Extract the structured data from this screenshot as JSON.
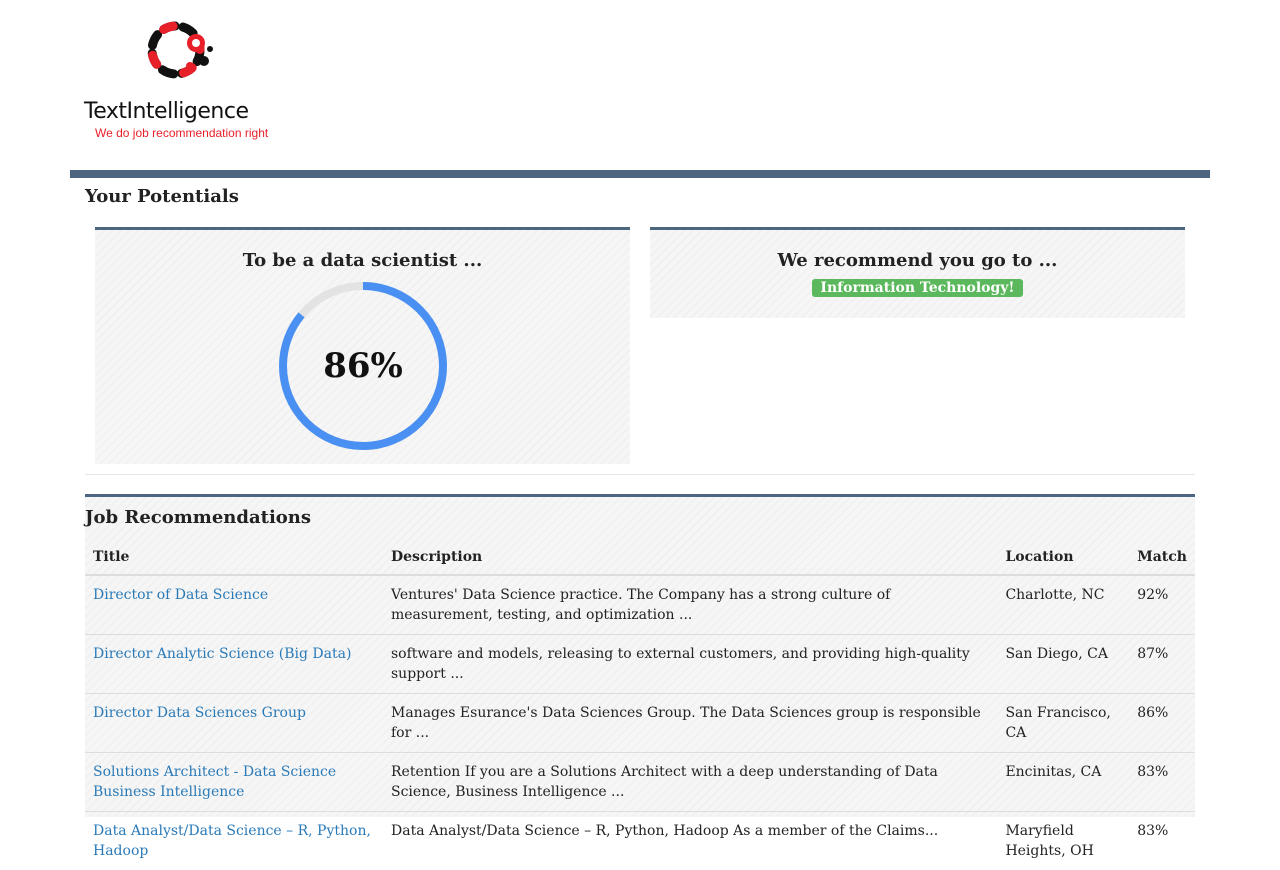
{
  "brand": {
    "name": "TextIntelligence",
    "tagline": "We do job recommendation right"
  },
  "potentials": {
    "title": "Your Potentials",
    "scientist_card": {
      "heading": "To be a data scientist ...",
      "percent_label": "86%",
      "percent_value": 86
    },
    "recommend_card": {
      "heading": "We recommend you go to ...",
      "badge": "Information Technology!"
    }
  },
  "jobs": {
    "title": "Job Recommendations",
    "columns": [
      "Title",
      "Description",
      "Location",
      "Match"
    ],
    "rows": [
      {
        "title": "Director of Data Science",
        "description": "Ventures' Data Science practice. The Company has a strong culture of measurement, testing, and optimization ...",
        "location": "Charlotte, NC",
        "match": "92%"
      },
      {
        "title": "Director Analytic Science (Big Data)",
        "description": "software and models, releasing to external customers, and providing high-quality support ...",
        "location": "San Diego, CA",
        "match": "87%"
      },
      {
        "title": "Director Data Sciences Group",
        "description": "Manages Esurance's Data Sciences Group. The Data Sciences group is responsible for ...",
        "location": "San Francisco, CA",
        "match": "86%"
      },
      {
        "title": "Solutions Architect - Data Science Business Intelligence",
        "description": "Retention If you are a Solutions Architect with a deep understanding of Data Science, Business Intelligence ...",
        "location": "Encinitas, CA",
        "match": "83%"
      },
      {
        "title": "Data Analyst/Data Science – R, Python, Hadoop",
        "description": "Data Analyst/Data Science – R, Python, Hadoop As a member of the Claims...",
        "location": "Maryfield Heights, OH",
        "match": "83%"
      }
    ]
  },
  "colors": {
    "accent_bar": "#4e6580",
    "link": "#2a7ab8",
    "gauge_fill": "#4a8ff2",
    "gauge_track": "#e3e3e3",
    "badge": "#5cb85c",
    "tagline": "#e8202a"
  }
}
